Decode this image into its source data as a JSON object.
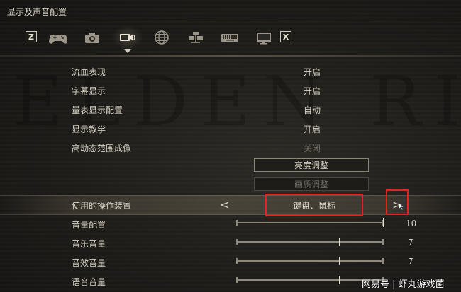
{
  "header": {
    "title": "显示及声音配置"
  },
  "tabs": {
    "left_key": "Z",
    "right_key": "X",
    "items": [
      {
        "icon": "gamepad-icon"
      },
      {
        "icon": "camera-icon"
      },
      {
        "icon": "display-sound-icon",
        "active": true
      },
      {
        "icon": "globe-icon"
      },
      {
        "icon": "network-icon"
      },
      {
        "icon": "keyboard-icon"
      },
      {
        "icon": "monitor-icon"
      }
    ]
  },
  "settings": {
    "blood_effects": {
      "label": "流血表现",
      "value": "开启"
    },
    "subtitles": {
      "label": "字幕显示",
      "value": "开启"
    },
    "hud": {
      "label": "量表显示配置",
      "value": "自动"
    },
    "tutorials": {
      "label": "显示教学",
      "value": "开启"
    },
    "hdr": {
      "label": "高动态范围成像",
      "value": "关闭"
    },
    "brightness_button": "亮度调整",
    "image_quality_button": "画质调整",
    "input_device": {
      "label": "使用的操作装置",
      "value": "键盘、鼠标",
      "prev": "<",
      "next": ">"
    },
    "master_volume": {
      "label": "音量配置",
      "value": "10",
      "level": 10,
      "max": 10
    },
    "music_volume": {
      "label": "音乐音量",
      "value": "7",
      "level": 7,
      "max": 10
    },
    "sfx_volume": {
      "label": "音效音量",
      "value": "7",
      "level": 7,
      "max": 10
    },
    "voice_volume": {
      "label": "语音音量",
      "value": "",
      "level": 7,
      "max": 10
    }
  },
  "watermark": {
    "text": "网易号 | 虾丸游戏菌"
  },
  "colors": {
    "highlight": "#e8231d",
    "text": "#d6d1c3",
    "disabled": "#6e6a60"
  }
}
